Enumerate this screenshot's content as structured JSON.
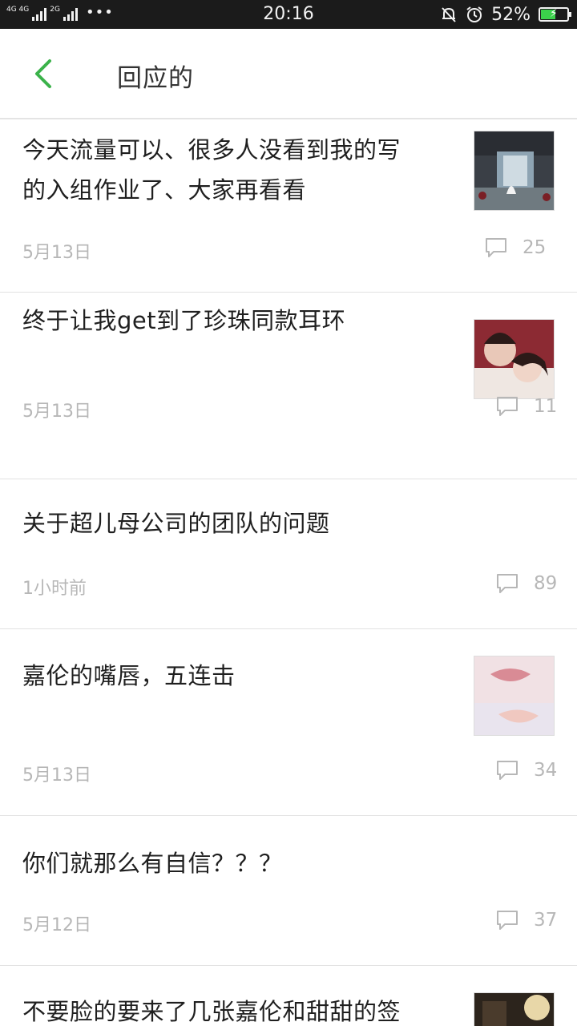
{
  "status_bar": {
    "network_left": "4G 4G",
    "network_right": "2G",
    "dots": "•••",
    "time": "20:16",
    "battery_percent": "52%",
    "battery_level": 0.52,
    "icons": [
      "mute-bell-icon",
      "alarm-icon",
      "battery-charging-icon"
    ]
  },
  "header": {
    "title": "回应的",
    "back_icon": "chevron-left-icon",
    "accent": "#3bb24a"
  },
  "posts": [
    {
      "title_lines": [
        "今天流量可以、很多人没看到我的写",
        "的入组作业了、大家再看看"
      ],
      "date": "5月13日",
      "comments": "25",
      "thumb": "palace-scene"
    },
    {
      "title_lines": [
        "终于让我get到了珍珠同款耳环"
      ],
      "date": "5月13日",
      "comments": "11",
      "thumb": "couple-portrait"
    },
    {
      "title_lines": [
        "关于超儿母公司的团队的问题"
      ],
      "date": "1小时前",
      "comments": "89",
      "thumb": null
    },
    {
      "title_lines": [
        "嘉伦的嘴唇，五连击"
      ],
      "date": "5月13日",
      "comments": "34",
      "thumb": "lips-closeup"
    },
    {
      "title_lines": [
        "你们就那么有自信？？？"
      ],
      "date": "5月12日",
      "comments": "37",
      "thumb": null
    },
    {
      "title_lines": [
        "不要脸的要来了几张嘉伦和甜甜的签"
      ],
      "date": "",
      "comments": "",
      "thumb": "dark-stage"
    }
  ]
}
